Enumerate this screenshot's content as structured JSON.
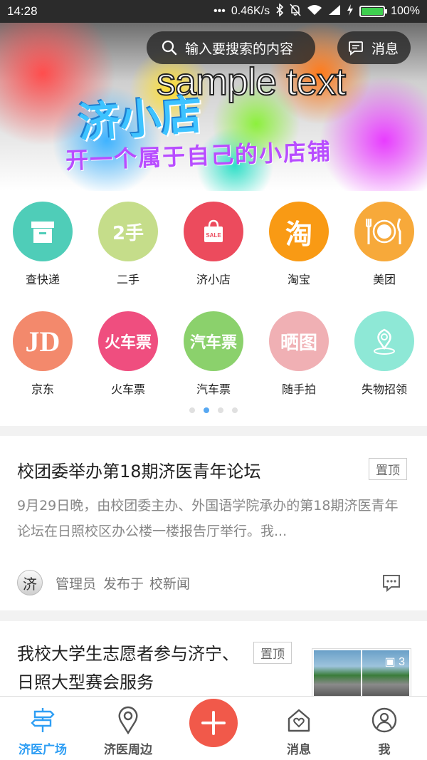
{
  "status_bar": {
    "time": "14:28",
    "speed": "0.46K/s",
    "battery": "100%",
    "battery_level": 1.0
  },
  "banner": {
    "overlay_text": "sample text",
    "shop_name": "济小店",
    "slogan": "开一个属于自己的小店铺"
  },
  "search": {
    "placeholder": "输入要搜索的内容",
    "icon": "search-icon"
  },
  "messages_button": {
    "label": "消息",
    "icon": "chat-bubble-icon"
  },
  "grid": {
    "items": [
      {
        "label": "查快递",
        "icon": "box-icon",
        "color": "#4fcdb8"
      },
      {
        "label": "二手",
        "icon": "second-hand-icon",
        "icon_text": "2手",
        "color": "#c5dd8a"
      },
      {
        "label": "济小店",
        "icon": "shopping-bag-icon",
        "icon_text": "SALE",
        "color": "#ec4b5d"
      },
      {
        "label": "淘宝",
        "icon": "taobao-icon",
        "icon_text": "淘",
        "color": "#f99a14"
      },
      {
        "label": "美团",
        "icon": "plate-utensils-icon",
        "color": "#f7a93a"
      },
      {
        "label": "京东",
        "icon": "jd-icon",
        "icon_text": "JD",
        "color": "#f3896c"
      },
      {
        "label": "火车票",
        "icon": "train-ticket-icon",
        "icon_text": "火车票",
        "color": "#ef4e7f"
      },
      {
        "label": "汽车票",
        "icon": "bus-ticket-icon",
        "icon_text": "汽车票",
        "color": "#8bd16c"
      },
      {
        "label": "随手拍",
        "icon": "photo-icon",
        "icon_text": "晒图",
        "color": "#f0b0b4"
      },
      {
        "label": "失物招领",
        "icon": "location-pin-icon",
        "color": "#8ee8d6"
      }
    ],
    "page_count": 4,
    "active_page": 2
  },
  "feed": [
    {
      "title": "校团委举办第18期济医青年论坛",
      "tag": "置顶",
      "summary": "9月29日晚，由校团委主办、外国语学院承办的第18期济医青年论坛在日照校区办公楼一楼报告厅举行。我...",
      "avatar_text": "济",
      "author": "管理员",
      "published_in": "发布于",
      "channel": "校新闻"
    },
    {
      "title": "我校大学生志愿者参与济宁、日照大型赛会服务",
      "tag": "置顶",
      "image_count": "3"
    }
  ],
  "bottom_nav": {
    "items": [
      {
        "label": "济医广场",
        "icon": "signpost-icon",
        "active": true
      },
      {
        "label": "济医周边",
        "icon": "map-pin-icon",
        "active": false
      },
      {
        "label": "",
        "icon": "plus-icon",
        "active": false
      },
      {
        "label": "消息",
        "icon": "house-heart-icon",
        "active": false
      },
      {
        "label": "我",
        "icon": "user-icon",
        "active": false
      }
    ]
  },
  "colors": {
    "accent": "#2e9ef4",
    "plus_button": "#f1594a",
    "status_bar": "#2b2b2b"
  }
}
